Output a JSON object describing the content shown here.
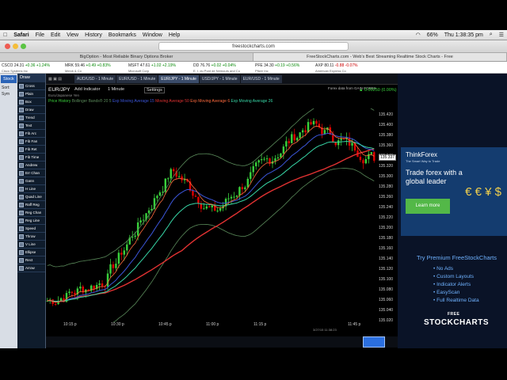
{
  "menubar": {
    "app_name": "Safari",
    "items": [
      "File",
      "Edit",
      "View",
      "History",
      "Bookmarks",
      "Window",
      "Help"
    ],
    "battery": "66%",
    "clock": "Thu 1:38:35 pm"
  },
  "browser": {
    "url": "freestockcharts.com",
    "tabs": [
      {
        "label": "BigOption - Most Reliable Binary Options Broker",
        "active": false
      },
      {
        "label": "FreeStockCharts.com - Web's Best Streaming Realtime Stock Charts - Free",
        "active": true
      }
    ]
  },
  "ticker": [
    {
      "sym": "CSCO",
      "price": "24.31",
      "chg": "+0.36",
      "pct": "+1.24%",
      "name": "Cisco Systems Inc"
    },
    {
      "sym": "MRK",
      "price": "59.46",
      "chg": "+0.49",
      "pct": "+0.83%",
      "name": "Merck & Co"
    },
    {
      "sym": "MSFT",
      "price": "47.61",
      "chg": "+1.02",
      "pct": "+2.19%",
      "name": "Microsoft Corp"
    },
    {
      "sym": "DD",
      "price": "76.76",
      "chg": "+0.02",
      "pct": "+0.04%",
      "name": "E. I. du Pont de Nemours and Co"
    },
    {
      "sym": "PFE",
      "price": "34.30",
      "chg": "+0.19",
      "pct": "+0.56%",
      "name": "Pfizer Inc"
    },
    {
      "sym": "AXP",
      "price": "80.11",
      "chg": "-0.88",
      "pct": "-0.07%",
      "name": "American Express Co"
    }
  ],
  "left_sidebar": {
    "stock_button": "Stock",
    "label1": "Sort:",
    "label2": "Sym"
  },
  "toolbox": {
    "title": "Draw",
    "tools": [
      "Cross",
      "Plain",
      "Box",
      "Draw",
      "Trend",
      "Text",
      "Fib Arc",
      "Fib Fan",
      "Fib Ret",
      "Fib Time",
      "Andrew",
      "Err Chan",
      "Gann",
      "H Line",
      "Quad Line",
      "Raff Reg",
      "Reg Chan",
      "Reg Line",
      "Speed",
      "Throw",
      "V Line",
      "Ellipse",
      "Rect",
      "Arrow"
    ]
  },
  "chart_tabs": [
    {
      "label": "AUD/USD - 1 Minute",
      "active": false
    },
    {
      "label": "EUR/USD - 1 Minute",
      "active": false
    },
    {
      "label": "EUR/JPY - 1 Minute",
      "active": true
    },
    {
      "label": "USD/JPY - 1 Minute",
      "active": false
    },
    {
      "label": "EUR/USD - 1 Minute",
      "active": false
    }
  ],
  "chart_header": {
    "symbol": "EUR/JPY",
    "add_indicator": "Add Indicator",
    "interval": "1 Minute",
    "settings": "Settings",
    "subtitle": "Euro/Japanese Yen",
    "data_provider": "Forex data from GAIN FOREX",
    "quote": "▲ 0.00250 (0.00%)",
    "legend": [
      {
        "label": "Price History",
        "color": "#39d03c"
      },
      {
        "label": "Bollinger Bands® 20 5",
        "color": "#5a8a5a"
      },
      {
        "label": "Exp Moving Average 15",
        "color": "#3b55d8"
      },
      {
        "label": "Moving Average 50",
        "color": "#e23232"
      },
      {
        "label": "Exp Moving Average 6",
        "color": "#ff6a3d"
      },
      {
        "label": "Exp Moving Average 26",
        "color": "#37d6a6"
      }
    ]
  },
  "price_axis": [
    "135.420",
    "135.400",
    "135.380",
    "135.360",
    "135.340",
    "135.320",
    "135.300",
    "135.280",
    "135.260",
    "135.240",
    "135.220",
    "135.200",
    "135.180",
    "135.160",
    "135.140",
    "135.120",
    "135.100",
    "135.080",
    "135.060",
    "135.040",
    "135.020"
  ],
  "current_price": "135.337",
  "time_axis": [
    "10:15 p",
    "10:30 p",
    "10:45 p",
    "11:00 p",
    "11:15 p",
    "11:45 p"
  ],
  "time_axis_date": "3/27/15 11:38:23",
  "ad": {
    "brand": "ThinkForex",
    "tagline": "The Smart Way to Trade",
    "message": "Trade forex with a global leader",
    "button": "Learn more",
    "coins": "€ € ¥ $"
  },
  "promo": {
    "title": "Try Premium FreeStockCharts",
    "features": [
      "No Ads",
      "Custom Layouts",
      "Indicator Alerts",
      "EasyScan",
      "Full Realtime Data"
    ],
    "brand": "STOCKCHARTS",
    "brand_prefix": "FREE"
  },
  "colors": {
    "up": "#39d03c",
    "down": "#e00000",
    "accent": "#2b6fe0"
  }
}
